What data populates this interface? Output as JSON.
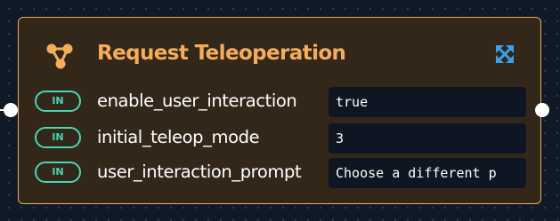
{
  "node": {
    "title": "Request Teleoperation",
    "header_icon": "node-graph-icon",
    "expand_icon": "expand-arrows-icon",
    "accent_color": "#f5ad5b",
    "port_color": "#49d6b3",
    "ports": [
      {
        "direction": "IN",
        "name": "enable_user_interaction",
        "value": "true"
      },
      {
        "direction": "IN",
        "name": "initial_teleop_mode",
        "value": "3"
      },
      {
        "direction": "IN",
        "name": "user_interaction_prompt",
        "value": "Choose a different p"
      }
    ]
  }
}
